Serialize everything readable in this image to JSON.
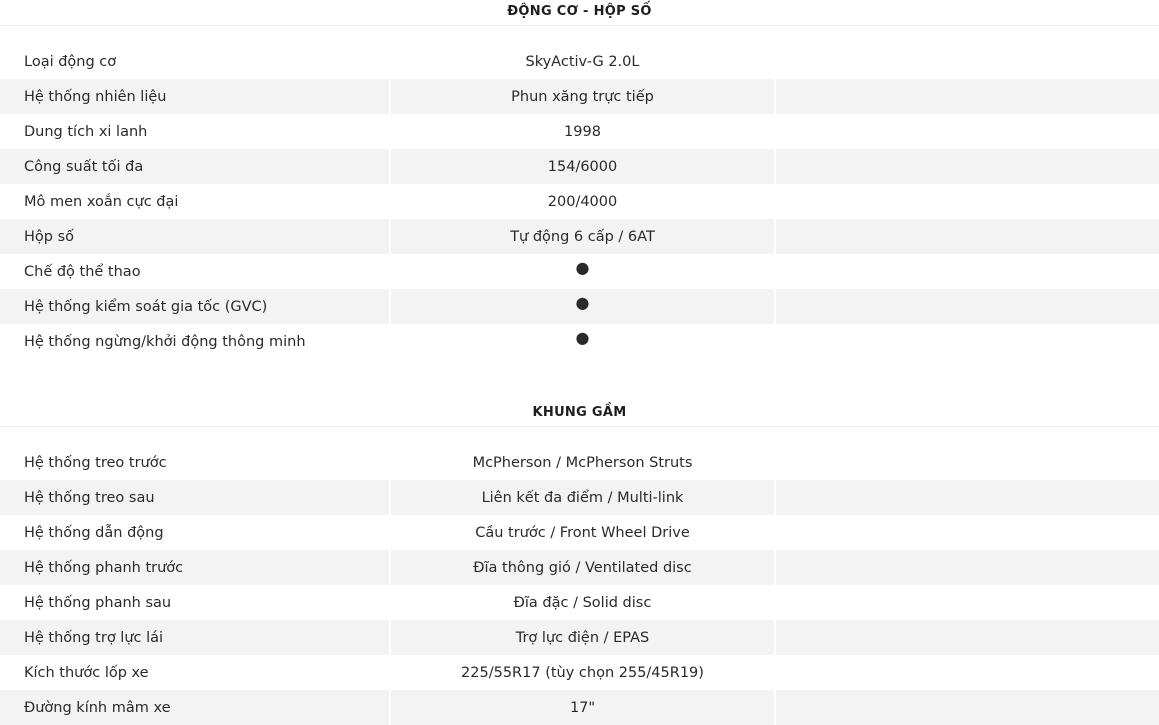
{
  "engine_section": {
    "title": "ĐỘNG CƠ - HỘP SỐ",
    "rows": [
      {
        "label": "Loại động cơ",
        "value": "SkyActiv-G 2.0L"
      },
      {
        "label": "Hệ thống nhiên liệu",
        "value": "Phun xăng trực tiếp"
      },
      {
        "label": "Dung tích xi lanh",
        "value": "1998"
      },
      {
        "label": "Công suất tối đa",
        "value": "154/6000"
      },
      {
        "label": "Mô men xoắn cực đại",
        "value": "200/4000"
      },
      {
        "label": "Hộp số",
        "value": "Tự động 6 cấp / 6AT"
      },
      {
        "label": "Chế độ thể thao",
        "value": "●"
      },
      {
        "label": "Hệ thống kiểm soát gia tốc (GVC)",
        "value": "●"
      },
      {
        "label": "Hệ thống ngừng/khởi động thông minh",
        "value": "●"
      }
    ]
  },
  "chassis_section": {
    "title": "KHUNG GẦM",
    "rows": [
      {
        "label": "Hệ thống treo trước",
        "value": "McPherson / McPherson Struts"
      },
      {
        "label": "Hệ thống treo sau",
        "value": "Liên kết đa điểm / Multi-link"
      },
      {
        "label": "Hệ thống dẫn động",
        "value": "Cầu trước / Front Wheel Drive"
      },
      {
        "label": "Hệ thống phanh trước",
        "value": "Đĩa thông gió / Ventilated disc"
      },
      {
        "label": "Hệ thống phanh sau",
        "value": "Đĩa đặc / Solid disc"
      },
      {
        "label": "Hệ thống trợ lực lái",
        "value": "Trợ lực điện / EPAS"
      },
      {
        "label": "Kích thước lốp xe",
        "value": "225/55R17 (tùy chọn 255/45R19)"
      },
      {
        "label": "Đường kính mâm xe",
        "value": "17\""
      }
    ]
  }
}
